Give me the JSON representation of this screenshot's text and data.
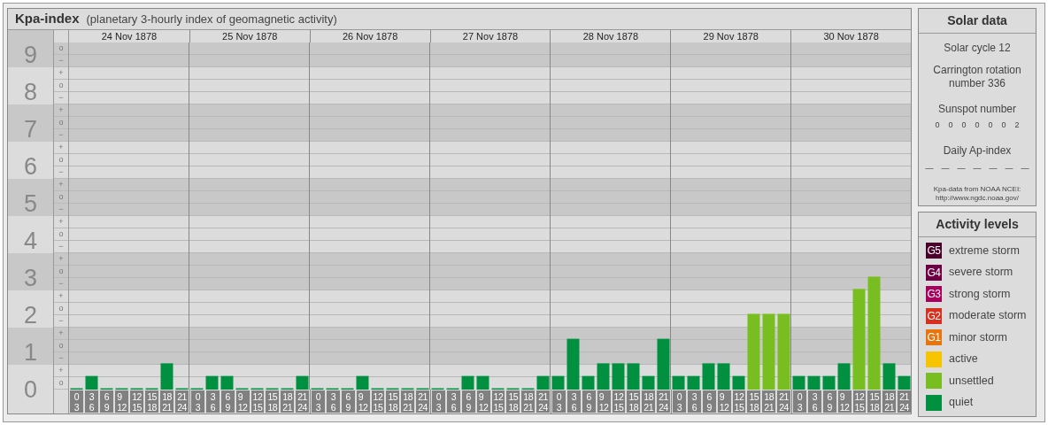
{
  "main_panel": {
    "title": "Kpa-index",
    "subtitle": "(planetary 3-hourly index of geomagnetic activity)",
    "minor_ticks": [
      [
        "o",
        "−"
      ],
      [
        "+",
        "o",
        "−"
      ],
      [
        "+",
        "o",
        "−"
      ],
      [
        "+",
        "o",
        "−"
      ],
      [
        "+",
        "o",
        "−"
      ],
      [
        "+",
        "o",
        "−"
      ],
      [
        "+",
        "o",
        "−"
      ],
      [
        "+",
        "o",
        "−"
      ],
      [
        "+",
        "o",
        "−"
      ],
      [
        "+",
        "o"
      ]
    ],
    "days": [
      {
        "date": "24 Nov 1878",
        "slots": [
          [
            "0",
            "3"
          ],
          [
            "3",
            "6"
          ],
          [
            "6",
            "9"
          ],
          [
            "9",
            "12"
          ],
          [
            "12",
            "15"
          ],
          [
            "15",
            "18"
          ],
          [
            "18",
            "21"
          ],
          [
            "21",
            "24"
          ]
        ]
      },
      {
        "date": "25 Nov 1878",
        "slots": [
          [
            "0",
            "3"
          ],
          [
            "3",
            "6"
          ],
          [
            "6",
            "9"
          ],
          [
            "9",
            "12"
          ],
          [
            "12",
            "15"
          ],
          [
            "15",
            "18"
          ],
          [
            "18",
            "21"
          ],
          [
            "21",
            "24"
          ]
        ]
      },
      {
        "date": "26 Nov 1878",
        "slots": [
          [
            "0",
            "3"
          ],
          [
            "3",
            "6"
          ],
          [
            "6",
            "9"
          ],
          [
            "9",
            "12"
          ],
          [
            "12",
            "15"
          ],
          [
            "15",
            "18"
          ],
          [
            "18",
            "21"
          ],
          [
            "21",
            "24"
          ]
        ]
      },
      {
        "date": "27 Nov 1878",
        "slots": [
          [
            "0",
            "3"
          ],
          [
            "3",
            "6"
          ],
          [
            "6",
            "9"
          ],
          [
            "9",
            "12"
          ],
          [
            "12",
            "15"
          ],
          [
            "15",
            "18"
          ],
          [
            "18",
            "21"
          ],
          [
            "21",
            "24"
          ]
        ]
      },
      {
        "date": "28 Nov 1878",
        "slots": [
          [
            "0",
            "3"
          ],
          [
            "3",
            "6"
          ],
          [
            "6",
            "9"
          ],
          [
            "9",
            "12"
          ],
          [
            "12",
            "15"
          ],
          [
            "15",
            "18"
          ],
          [
            "18",
            "21"
          ],
          [
            "21",
            "24"
          ]
        ]
      },
      {
        "date": "29 Nov 1878",
        "slots": [
          [
            "0",
            "3"
          ],
          [
            "3",
            "6"
          ],
          [
            "6",
            "9"
          ],
          [
            "9",
            "12"
          ],
          [
            "12",
            "15"
          ],
          [
            "15",
            "18"
          ],
          [
            "18",
            "21"
          ],
          [
            "21",
            "24"
          ]
        ]
      },
      {
        "date": "30 Nov 1878",
        "slots": [
          [
            "0",
            "3"
          ],
          [
            "3",
            "6"
          ],
          [
            "6",
            "9"
          ],
          [
            "9",
            "12"
          ],
          [
            "12",
            "15"
          ],
          [
            "15",
            "18"
          ],
          [
            "18",
            "21"
          ],
          [
            "21",
            "24"
          ]
        ]
      }
    ],
    "chart_data": {
      "type": "bar",
      "grid": true,
      "ylim": [
        0,
        9.33
      ],
      "yticks": [
        0,
        1,
        2,
        3,
        4,
        5,
        6,
        7,
        8,
        9
      ],
      "categories": [
        null,
        null,
        null,
        null,
        null,
        null,
        null,
        null,
        null,
        null,
        null,
        null,
        null,
        null,
        null,
        null,
        null,
        null,
        null,
        null,
        null,
        null,
        null,
        null,
        null,
        null,
        null,
        null,
        null,
        null,
        null,
        null,
        null,
        null,
        null,
        null,
        null,
        null,
        null,
        null,
        null,
        null,
        null,
        null,
        null,
        null,
        null,
        null,
        null,
        null,
        null,
        null,
        null,
        null,
        null,
        null
      ],
      "series": [
        {
          "color": "#00903f",
          "values": [
            0,
            0.33,
            0,
            0,
            0,
            0,
            0.67,
            0,
            0,
            0.33,
            0.33,
            0,
            0,
            0,
            0,
            0.33,
            0,
            0,
            0,
            0.33,
            0,
            0,
            0,
            0,
            0,
            0,
            0.33,
            0.33,
            0,
            0,
            0,
            0.33,
            0.33,
            1.33,
            0.33,
            0.67,
            0.67,
            0.67,
            0.33,
            1.33,
            0.33,
            0.33,
            0.67,
            0.67,
            0.33,
            null,
            null,
            null,
            0.33,
            0.33,
            0.33,
            0.67,
            null,
            null,
            0.67,
            0.33
          ]
        },
        {
          "color": "#78be20",
          "values": [
            null,
            null,
            null,
            null,
            null,
            null,
            null,
            null,
            null,
            null,
            null,
            null,
            null,
            null,
            null,
            null,
            null,
            null,
            null,
            null,
            null,
            null,
            null,
            null,
            null,
            null,
            null,
            null,
            null,
            null,
            null,
            null,
            null,
            null,
            null,
            null,
            null,
            null,
            null,
            null,
            null,
            null,
            null,
            null,
            null,
            2,
            2,
            2,
            null,
            null,
            null,
            null,
            2.67,
            3,
            null,
            null
          ]
        }
      ]
    }
  },
  "solar_data": {
    "title": "Solar data",
    "solar_cycle": "Solar cycle 12",
    "carrington": "Carrington rotation number 336",
    "sunspot_label": "Sunspot number",
    "sunspot_values": [
      "0",
      "0",
      "0",
      "0",
      "0",
      "0",
      "2"
    ],
    "ap_label": "Daily Ap-index",
    "ap_values": [
      "—",
      "—",
      "—",
      "—",
      "—",
      "—",
      "—"
    ],
    "source": "Kpa-data from NOAA NCEI:",
    "source_url": "http://www.ngdc.noaa.gov/"
  },
  "activity_levels": {
    "title": "Activity levels",
    "items": [
      {
        "badge": "G5",
        "label": "extreme storm",
        "color": "#4a0028"
      },
      {
        "badge": "G4",
        "label": "severe storm",
        "color": "#6e0043"
      },
      {
        "badge": "G3",
        "label": "strong storm",
        "color": "#a8005c"
      },
      {
        "badge": "G2",
        "label": "moderate storm",
        "color": "#d7301f"
      },
      {
        "badge": "G1",
        "label": "minor storm",
        "color": "#e8760f"
      },
      {
        "label": "active",
        "color": "#f7c400"
      },
      {
        "label": "unsettled",
        "color": "#78be20"
      },
      {
        "label": "quiet",
        "color": "#00903f"
      }
    ]
  }
}
